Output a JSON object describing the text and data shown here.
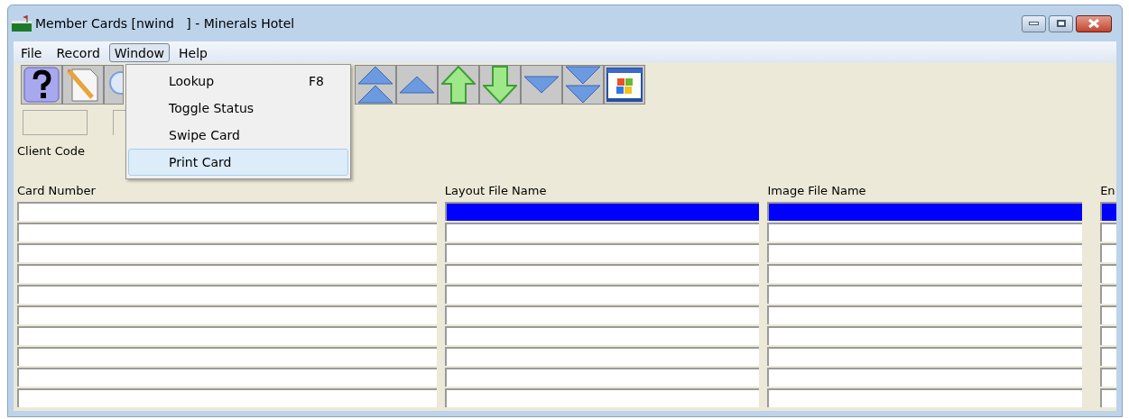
{
  "window": {
    "title": "Member Cards [nwind   ] - Minerals Hotel"
  },
  "menu_bar": [
    {
      "label": "File",
      "selected": false
    },
    {
      "label": "Record",
      "selected": false
    },
    {
      "label": "Window",
      "selected": true
    },
    {
      "label": "Help",
      "selected": false
    }
  ],
  "open_menu": {
    "items": [
      {
        "label": "Lookup",
        "shortcut": "F8",
        "selected": false
      },
      {
        "label": "Toggle Status",
        "selected": false
      },
      {
        "label": "Swipe Card",
        "selected": false
      },
      {
        "label": "Print Card",
        "selected": true
      }
    ]
  },
  "form": {
    "client_code_label": "Client Code"
  },
  "grid": {
    "columns": [
      "Card Number",
      "Layout File Name",
      "Image File Name",
      "En"
    ],
    "rows": [
      {
        "selected": true
      },
      {
        "selected": false
      },
      {
        "selected": false
      },
      {
        "selected": false
      },
      {
        "selected": false
      },
      {
        "selected": false
      },
      {
        "selected": false
      },
      {
        "selected": false
      },
      {
        "selected": false
      },
      {
        "selected": false
      }
    ]
  }
}
